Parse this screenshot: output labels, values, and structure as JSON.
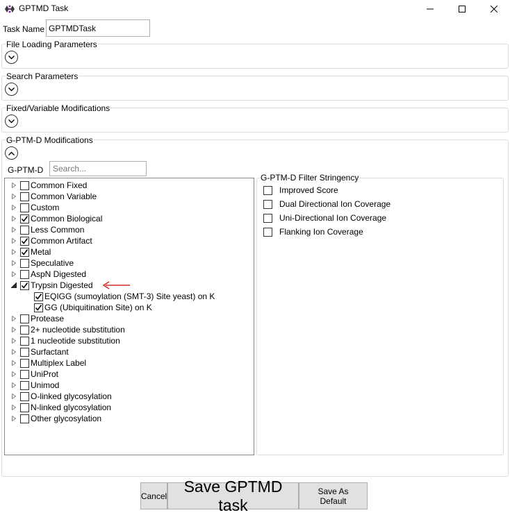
{
  "window": {
    "title": "GPTMD Task",
    "min_glyph": "—",
    "max_glyph": "☐",
    "close_glyph": "✕",
    "icon": "app-icon"
  },
  "task_name": {
    "label": "Task Name",
    "value": "GPTMDTask"
  },
  "sections": {
    "file_loading": "File Loading Parameters",
    "search_params": "Search Parameters",
    "fixed_variable": "Fixed/Variable Modifications",
    "gptmd_mods": "G-PTM-D Modifications"
  },
  "gptmd": {
    "label": "G-PTM-D",
    "search_placeholder": "Search...",
    "tree": [
      {
        "label": "Common Fixed",
        "checked": false,
        "expanded": false
      },
      {
        "label": "Common Variable",
        "checked": false,
        "expanded": false
      },
      {
        "label": "Custom",
        "checked": false,
        "expanded": false
      },
      {
        "label": "Common Biological",
        "checked": true,
        "expanded": false
      },
      {
        "label": "Less Common",
        "checked": false,
        "expanded": false
      },
      {
        "label": "Common Artifact",
        "checked": true,
        "expanded": false
      },
      {
        "label": "Metal",
        "checked": true,
        "expanded": false
      },
      {
        "label": "Speculative",
        "checked": false,
        "expanded": false
      },
      {
        "label": "AspN Digested",
        "checked": false,
        "expanded": false
      },
      {
        "label": "Trypsin Digested",
        "checked": true,
        "expanded": true,
        "children": [
          {
            "label": "EQIGG (sumoylation (SMT-3) Site yeast) on K",
            "checked": true
          },
          {
            "label": "GG (Ubiquitination Site) on K",
            "checked": true
          }
        ]
      },
      {
        "label": "Protease",
        "checked": false,
        "expanded": false
      },
      {
        "label": "2+ nucleotide substitution",
        "checked": false,
        "expanded": false
      },
      {
        "label": "1 nucleotide substitution",
        "checked": false,
        "expanded": false
      },
      {
        "label": "Surfactant",
        "checked": false,
        "expanded": false
      },
      {
        "label": "Multiplex Label",
        "checked": false,
        "expanded": false
      },
      {
        "label": "UniProt",
        "checked": false,
        "expanded": false
      },
      {
        "label": "Unimod",
        "checked": false,
        "expanded": false
      },
      {
        "label": "O-linked glycosylation",
        "checked": false,
        "expanded": false
      },
      {
        "label": "N-linked glycosylation",
        "checked": false,
        "expanded": false
      },
      {
        "label": "Other glycosylation",
        "checked": false,
        "expanded": false
      }
    ]
  },
  "filter": {
    "title": "G-PTM-D Filter Stringency",
    "options": [
      {
        "label": "Improved Score",
        "checked": false
      },
      {
        "label": "Dual Directional Ion Coverage",
        "checked": false
      },
      {
        "label": "Uni-Directional Ion Coverage",
        "checked": false
      },
      {
        "label": "Flanking Ion Coverage",
        "checked": false
      }
    ]
  },
  "buttons": {
    "cancel": "Cancel",
    "save_task": "Save GPTMD task",
    "save_default": "Save As Default"
  },
  "colors": {
    "annotation_arrow": "#d62b2b",
    "border": "#dcdcdc",
    "button_bg": "#e1e1e1"
  }
}
